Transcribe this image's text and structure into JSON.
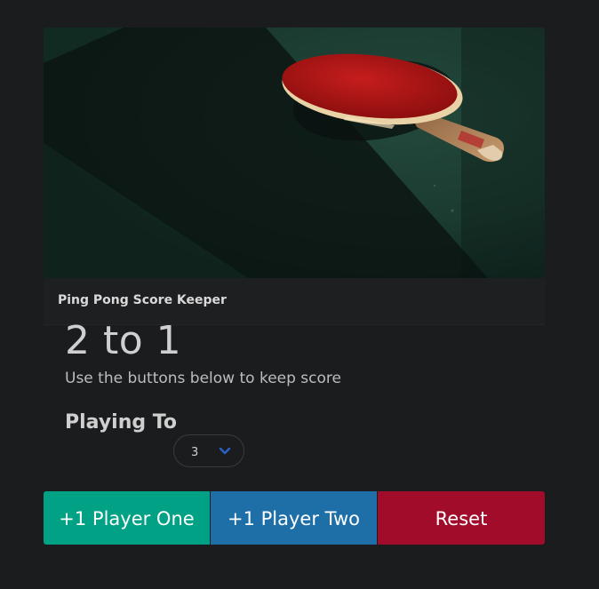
{
  "card": {
    "hero_image": "ping-pong-paddle-photo",
    "header_title": "Ping Pong Score Keeper"
  },
  "score": {
    "text": "2 to 1",
    "player_one": 2,
    "player_two": 1
  },
  "subtitle": "Use the buttons below to keep score",
  "playing_to": {
    "label": "Playing To",
    "selected": "3"
  },
  "buttons": {
    "player_one": "+1 Player One",
    "player_two": "+1 Player Two",
    "reset": "Reset"
  },
  "colors": {
    "player_one": "#00a184",
    "player_two": "#1e6fa8",
    "reset": "#a10c2a",
    "background": "#1b1c1e"
  },
  "icons": {
    "select_arrow": "chevron-down-icon"
  }
}
